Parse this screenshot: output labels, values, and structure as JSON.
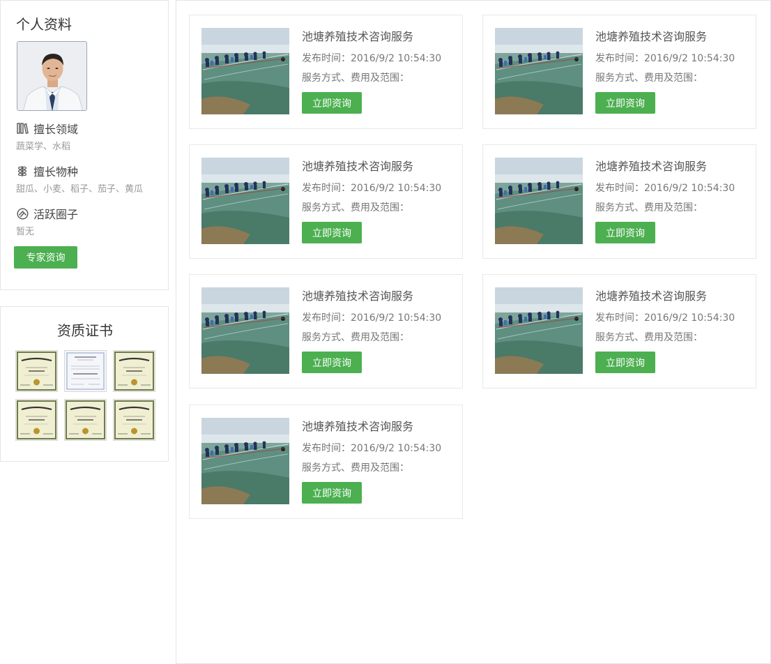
{
  "profile": {
    "title": "个人资料",
    "field_heading": "擅长领域",
    "field_value": "蔬菜学、水稻",
    "species_heading": "擅长物种",
    "species_value": "甜瓜、小麦、稻子、茄子、黄瓜",
    "circle_heading": "活跃圈子",
    "circle_value": "暂无",
    "consult_button": "专家资询"
  },
  "certificates": {
    "title": "资质证书"
  },
  "services": [
    {
      "title": "池塘养殖技术咨询服务",
      "date": "发布时间：2016/9/2 10:54:30",
      "method": "服务方式、费用及范围：",
      "button": "立即资询"
    },
    {
      "title": "池塘养殖技术咨询服务",
      "date": "发布时间：2016/9/2 10:54:30",
      "method": "服务方式、费用及范围：",
      "button": "立即资询"
    },
    {
      "title": "池塘养殖技术咨询服务",
      "date": "发布时间：2016/9/2 10:54:30",
      "method": "服务方式、费用及范围：",
      "button": "立即资询"
    },
    {
      "title": "池塘养殖技术咨询服务",
      "date": "发布时间：2016/9/2 10:54:30",
      "method": "服务方式、费用及范围：",
      "button": "立即资询"
    },
    {
      "title": "池塘养殖技术咨询服务",
      "date": "发布时间：2016/9/2 10:54:30",
      "method": "服务方式、费用及范围：",
      "button": "立即资询"
    },
    {
      "title": "池塘养殖技术咨询服务",
      "date": "发布时间：2016/9/2 10:54:30",
      "method": "服务方式、费用及范围：",
      "button": "立即资询"
    },
    {
      "title": "池塘养殖技术咨询服务",
      "date": "发布时间：2016/9/2 10:54:30",
      "method": "服务方式、费用及范围：",
      "button": "立即资询"
    }
  ],
  "colors": {
    "accent_green": "#4caf50",
    "border": "#e5e5e5",
    "muted_text": "#999999"
  },
  "icons": {
    "field": "books-icon",
    "species": "plant-icon",
    "circle": "circle-network-icon"
  }
}
